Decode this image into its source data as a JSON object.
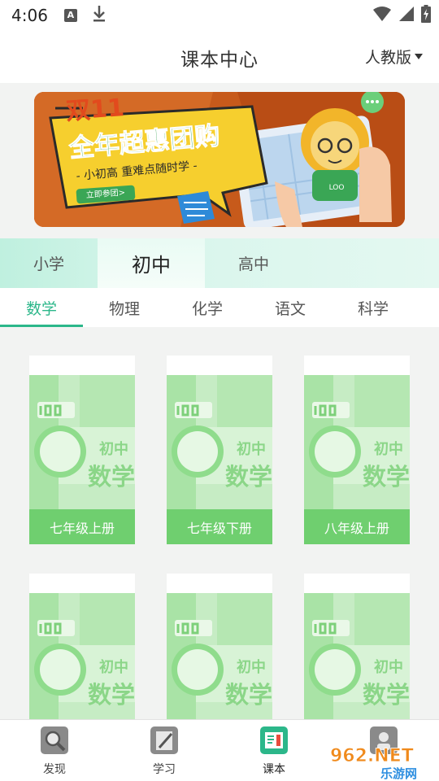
{
  "status_bar": {
    "time": "4:06"
  },
  "header": {
    "title": "课本中心",
    "edition": "人教版"
  },
  "banner": {
    "headline_1": "双11",
    "headline_2": "全年超惠团购",
    "subline": "- 小初高 重难点随时学 -",
    "cta": "立即参团>",
    "mascot_tag": "LOO"
  },
  "stages": [
    "小学",
    "初中",
    "高中"
  ],
  "subjects": [
    "数学",
    "物理",
    "化学",
    "语文",
    "科学"
  ],
  "books": [
    {
      "grade": "七年级上册",
      "cover_stage": "初中",
      "cover_subject": "数学",
      "cover_logo": "LOO"
    },
    {
      "grade": "七年级下册",
      "cover_stage": "初中",
      "cover_subject": "数学",
      "cover_logo": "LOO"
    },
    {
      "grade": "八年级上册",
      "cover_stage": "初中",
      "cover_subject": "数学",
      "cover_logo": "LOO"
    },
    {
      "grade": "",
      "cover_stage": "初中",
      "cover_subject": "数学",
      "cover_logo": "LOO"
    },
    {
      "grade": "",
      "cover_stage": "初中",
      "cover_subject": "数学",
      "cover_logo": "LOO"
    },
    {
      "grade": "",
      "cover_stage": "初中",
      "cover_subject": "数学",
      "cover_logo": "LOO"
    }
  ],
  "tabs": [
    "发现",
    "学习",
    "课本",
    ""
  ],
  "watermark": {
    "brand": "962.NET",
    "sub": "乐游网"
  },
  "colors": {
    "accent": "#2cb78a",
    "book_green": "#6fcf6f",
    "banner_bg": "#c75a1b",
    "banner_yellow": "#f6cf2e"
  }
}
